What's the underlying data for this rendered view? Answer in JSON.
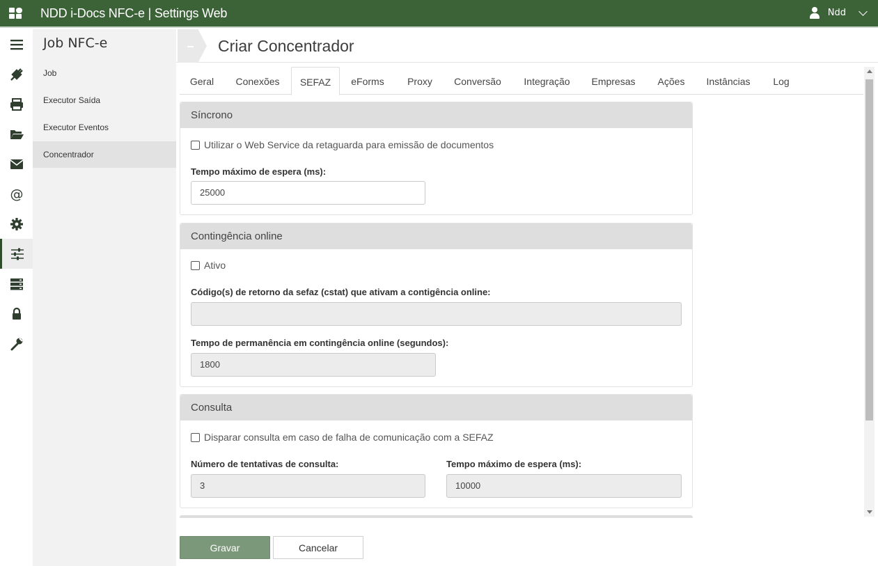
{
  "app": {
    "title": "NDD i-Docs NFC-e | Settings Web",
    "user": "Ndd"
  },
  "rail": {
    "icons": [
      "menu-icon",
      "plug-icon",
      "printer-icon",
      "folder-icon",
      "envelope-icon",
      "at-icon",
      "gear-icon",
      "sliders-icon",
      "server-icon",
      "lock-icon",
      "wrench-icon"
    ],
    "active": "sliders-icon"
  },
  "subnav": {
    "title": "Job NFC-e",
    "items": [
      "Job",
      "Executor Saída",
      "Executor Eventos",
      "Concentrador"
    ],
    "active": "Concentrador"
  },
  "page": {
    "title": "Criar Concentrador"
  },
  "tabs": {
    "items": [
      "Geral",
      "Conexões",
      "SEFAZ",
      "eForms",
      "Proxy",
      "Conversão",
      "Integração",
      "Empresas",
      "Ações",
      "Instâncias",
      "Log"
    ],
    "active": "SEFAZ"
  },
  "sincrono": {
    "title": "Síncrono",
    "checkbox_label": "Utilizar o Web Service da retaguarda para emissão de documentos",
    "checked": false,
    "timeout_label": "Tempo máximo de espera (ms):",
    "timeout_value": "25000"
  },
  "contingencia": {
    "title": "Contingência online",
    "checkbox_label": "Ativo",
    "checked": false,
    "codes_label": "Código(s) de retorno da sefaz (cstat) que ativam a contigência online:",
    "codes_value": "",
    "duration_label": "Tempo de permanência em contingência online (segundos):",
    "duration_value": "1800"
  },
  "consulta": {
    "title": "Consulta",
    "checkbox_label": "Disparar consulta em caso de falha de comunicação com a SEFAZ",
    "checked": false,
    "attempts_label": "Número de tentativas de consulta:",
    "attempts_value": "3",
    "timeout_label": "Tempo máximo de espera (ms):",
    "timeout_value": "10000"
  },
  "actions": {
    "save": "Gravar",
    "cancel": "Cancelar"
  },
  "colors": {
    "topbar": "#3b6337",
    "primary_button": "#7c987a",
    "panel_header": "#dedede",
    "sidebar_bg": "#f2f2f2"
  }
}
